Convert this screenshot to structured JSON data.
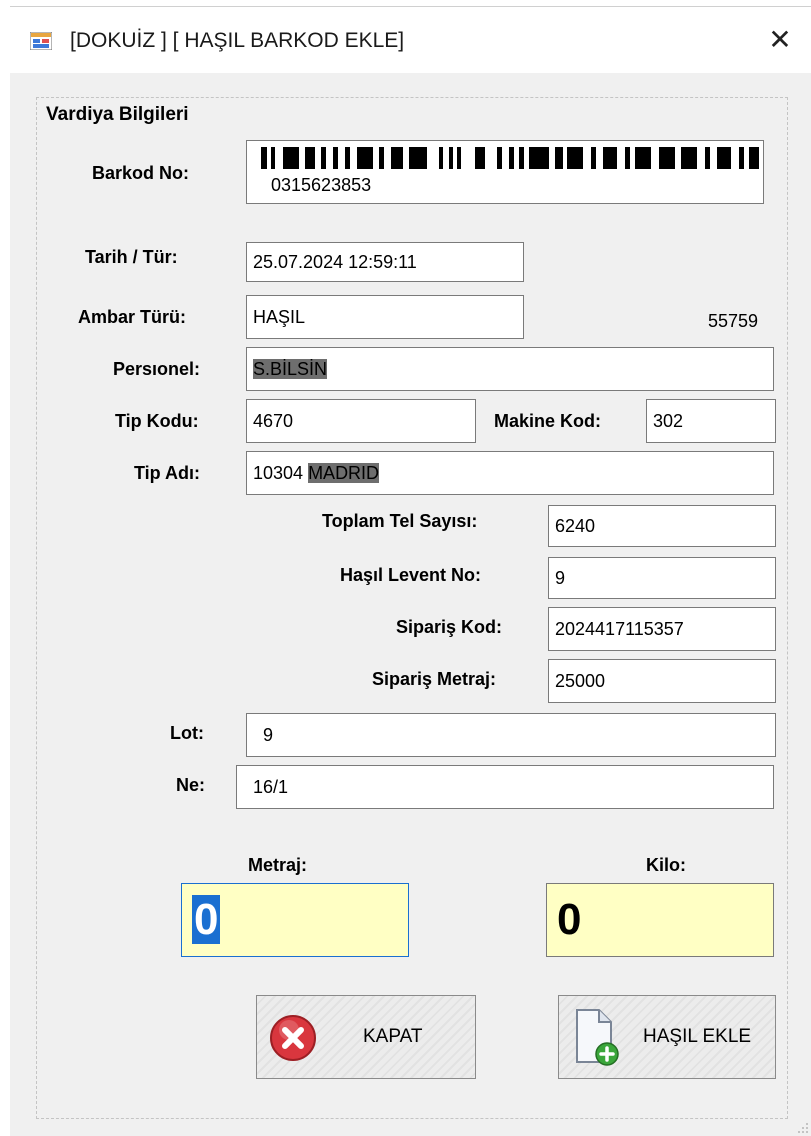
{
  "window": {
    "title": "[DOKUİZ ] [ HAŞIL BARKOD EKLE]"
  },
  "group": {
    "title": "Vardiya Bilgileri"
  },
  "barcode": {
    "label": "Barkod No:",
    "value": "0315623853"
  },
  "tarih": {
    "label": "Tarih / Tür:",
    "value": "25.07.2024 12:59:11"
  },
  "ambar": {
    "label": "Ambar Türü:",
    "value": "HAŞIL",
    "side_number": "55759"
  },
  "personel": {
    "label": "Persıonel:",
    "value": "S.BİLSİN"
  },
  "tip_kodu": {
    "label": "Tip Kodu:",
    "value": "4670"
  },
  "makine_kod": {
    "label": "Makine Kod:",
    "value": "302"
  },
  "tip_adi": {
    "label": "Tip Adı:",
    "value_prefix": "10304 ",
    "value_selected": "MADRID"
  },
  "toplam_tel": {
    "label": "Toplam Tel Sayısı:",
    "value": "6240"
  },
  "hasil_levent": {
    "label": "Haşıl Levent No:",
    "value": "9"
  },
  "siparis_kod": {
    "label": "Sipariş Kod:",
    "value": "2024417115357"
  },
  "siparis_metraj": {
    "label": "Sipariş Metraj:",
    "value": "25000"
  },
  "lot": {
    "label": "Lot:",
    "value": "9"
  },
  "ne": {
    "label": "Ne:",
    "value": "16/1"
  },
  "metraj": {
    "label": "Metraj:",
    "value": "0"
  },
  "kilo": {
    "label": "Kilo:",
    "value": "0"
  },
  "buttons": {
    "kapat": "KAPAT",
    "hasil_ekle": "HAŞIL EKLE"
  },
  "colors": {
    "input_highlight": "#ffffc4",
    "focus_border": "#1a6fd1",
    "close_icon_red": "#d9363e",
    "add_icon_green": "#3aa63a"
  },
  "icons": {
    "app": "form-icon",
    "close": "close-icon",
    "kapat": "cancel-x-icon",
    "hasil_ekle": "add-document-icon"
  }
}
